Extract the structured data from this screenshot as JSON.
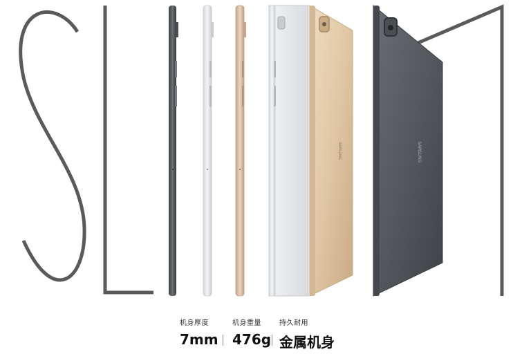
{
  "headline": {
    "word": "SLIM"
  },
  "brand": {
    "logo_text": "SAMSUNG"
  },
  "specs": [
    {
      "label": "机身厚度",
      "value": "7mm"
    },
    {
      "label": "机身重量",
      "value": "476g"
    },
    {
      "label": "持久耐用",
      "value": "金属机身"
    }
  ],
  "colors": {
    "letter_stroke": "#5a5a5a",
    "dark_gray": "#4f5257",
    "silver": "#e3e5e8",
    "rose_gold": "#d8b8a3",
    "gold": "#dcc3a1"
  },
  "icons": [
    "camera-lens-icon",
    "volume-button-icon",
    "power-button-icon"
  ]
}
